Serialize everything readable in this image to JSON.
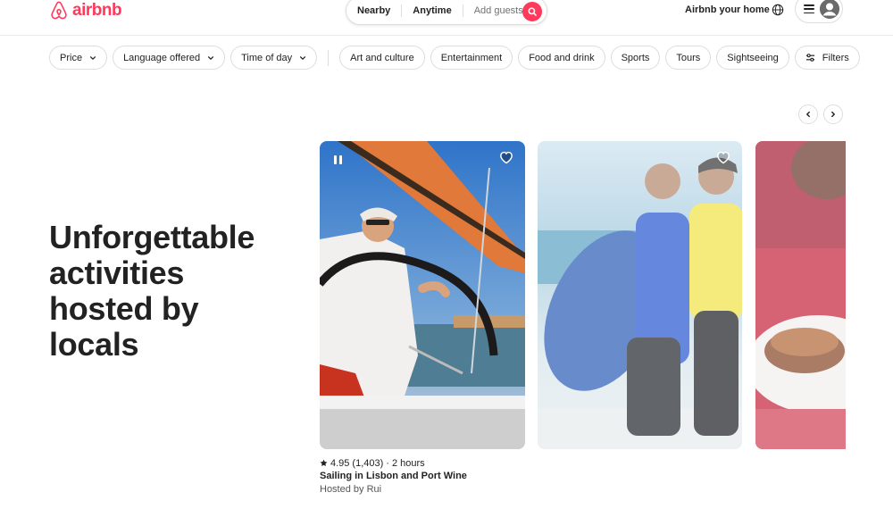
{
  "header": {
    "logo_text": "airbnb",
    "search": {
      "nearby": "Nearby",
      "anytime": "Anytime",
      "guests": "Add guests"
    },
    "host_link": "Airbnb your home"
  },
  "filters": {
    "dropdowns": [
      {
        "label": "Price"
      },
      {
        "label": "Language offered"
      },
      {
        "label": "Time of day"
      }
    ],
    "categories": [
      {
        "label": "Art and culture"
      },
      {
        "label": "Entertainment"
      },
      {
        "label": "Food and drink"
      },
      {
        "label": "Sports"
      },
      {
        "label": "Tours"
      },
      {
        "label": "Sightseeing"
      }
    ],
    "filters_button": "Filters"
  },
  "hero": {
    "line1": "Unforgettable",
    "line2": "activities",
    "line3": "hosted by",
    "line4": "locals"
  },
  "cards": [
    {
      "rating": "4.95",
      "reviews": "(1,403)",
      "separator": "·",
      "duration": "2 hours",
      "title": "Sailing in Lisbon and Port Wine",
      "host": "Hosted by Rui"
    }
  ],
  "colors": {
    "brand": "#ff385c",
    "text": "#222222",
    "border": "#dddddd"
  },
  "icons": [
    "airbnb-logo-icon",
    "search-icon",
    "globe-icon",
    "menu-icon",
    "avatar-icon",
    "chevron-down-icon",
    "filters-icon",
    "chevron-left-icon",
    "chevron-right-icon",
    "heart-icon",
    "pause-icon",
    "star-icon"
  ]
}
